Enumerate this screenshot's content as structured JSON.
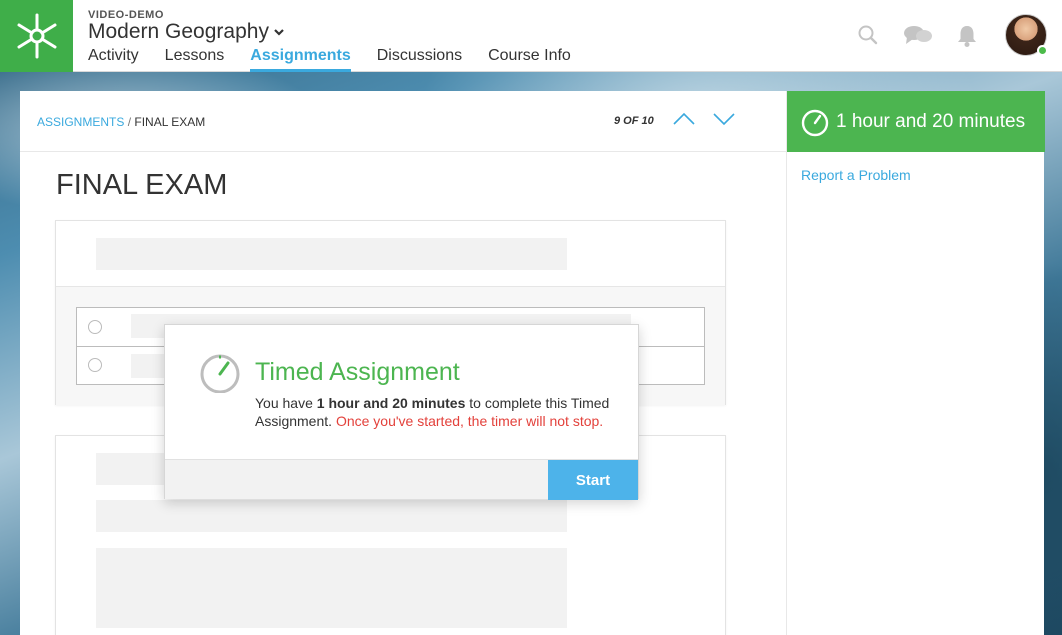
{
  "header": {
    "course_label": "VIDEO-DEMO",
    "course_title": "Modern Geography",
    "nav": [
      {
        "label": "Activity",
        "active": false
      },
      {
        "label": "Lessons",
        "active": false
      },
      {
        "label": "Assignments",
        "active": true
      },
      {
        "label": "Discussions",
        "active": false
      },
      {
        "label": "Course Info",
        "active": false
      }
    ],
    "icons": [
      "search-icon",
      "chat-icon",
      "bell-icon"
    ],
    "user_status": "online"
  },
  "breadcrumb": {
    "parent": "ASSIGNMENTS",
    "separator": "/",
    "current": "FINAL EXAM"
  },
  "pager": {
    "text": "9 OF 10"
  },
  "page_title": "FINAL EXAM",
  "sidebar": {
    "timer_text": "1 hour and 20 minutes",
    "report_link": "Report a Problem"
  },
  "modal": {
    "title": "Timed Assignment",
    "text_prefix": "You have ",
    "text_bold": "1 hour and 20 minutes",
    "text_suffix": " to complete this Timed Assignment.",
    "warning": "Once you've started, the timer will not stop.",
    "start_label": "Start"
  },
  "colors": {
    "brand_green": "#3fae49",
    "timer_green": "#4cb550",
    "link_blue": "#3aa9de",
    "button_blue": "#4db3ea",
    "warning_red": "#e3413b"
  }
}
